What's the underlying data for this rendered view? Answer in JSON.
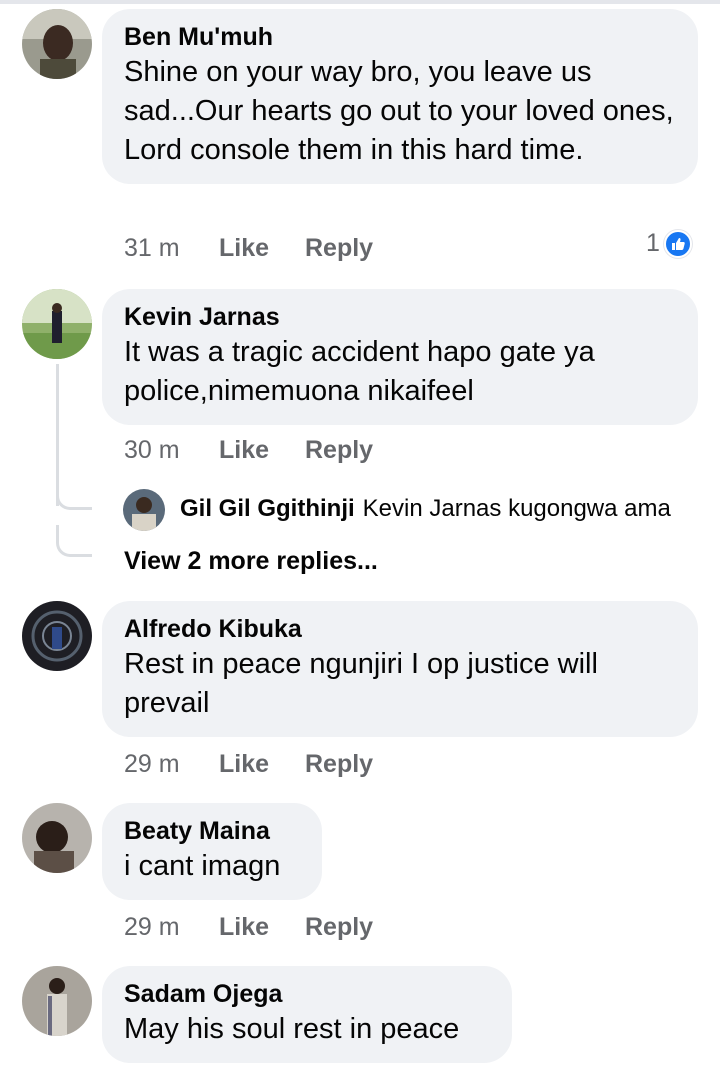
{
  "comments": [
    {
      "author": "Ben Mu'muh",
      "text": "Shine on your way bro, you leave us sad...Our hearts go out to your loved ones, Lord console them in this hard time.",
      "time": "31 m",
      "like_label": "Like",
      "reply_label": "Reply",
      "reaction_count": "1",
      "reaction_icon": "like-reaction-icon"
    },
    {
      "author": "Kevin Jarnas",
      "text": "It was a tragic accident hapo gate ya police,nimemuona nikaifeel",
      "time": "30 m",
      "like_label": "Like",
      "reply_label": "Reply",
      "reply_preview": {
        "author": "Gil Gil Ggithinji",
        "text": "Kevin Jarnas kugongwa ama"
      },
      "view_more_label": "View 2 more replies..."
    },
    {
      "author": "Alfredo Kibuka",
      "text": "Rest in peace ngunjiri I op justice will prevail",
      "time": "29 m",
      "like_label": "Like",
      "reply_label": "Reply"
    },
    {
      "author": "Beaty Maina",
      "text": "i cant imagn",
      "time": "29 m",
      "like_label": "Like",
      "reply_label": "Reply"
    },
    {
      "author": "Sadam Ojega",
      "text": "May his soul rest in peace"
    }
  ],
  "colors": {
    "bubble": "#f0f2f5",
    "meta_text": "#65676b",
    "like_blue": "#1877f2"
  }
}
